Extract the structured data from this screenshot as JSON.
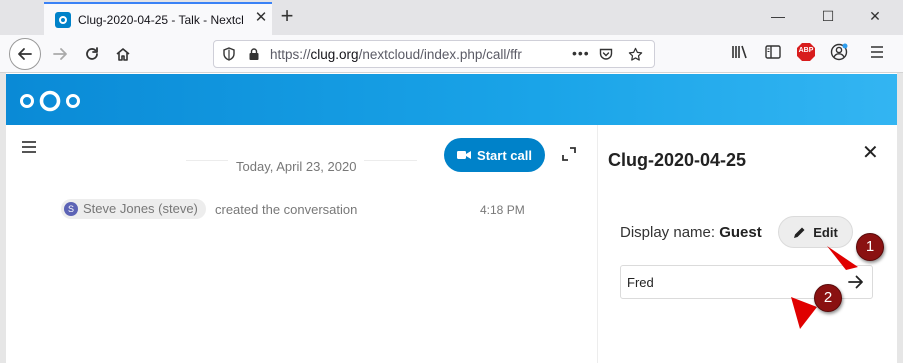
{
  "browser": {
    "tab_title": "Clug-2020-04-25 - Talk - Nextcl",
    "url_prefix": "https://",
    "url_host": "clug.org",
    "url_path": "/nextcloud/index.php/call/ffr",
    "abp_badge": "ABP"
  },
  "chat": {
    "date_separator": "Today, April 23, 2020",
    "start_call_label": "Start call",
    "message": {
      "avatar_initial": "S",
      "user": "Steve Jones (steve)",
      "text": "created the conversation",
      "time": "4:18 PM"
    }
  },
  "sidebar": {
    "title": "Clug-2020-04-25",
    "display_name_label": "Display name:",
    "display_name_value": "Guest",
    "edit_label": "Edit",
    "name_input_value": "Fred"
  },
  "annotations": {
    "marker_1": "1",
    "marker_2": "2",
    "marker_color": "#8a1111",
    "arrow_color": "#e00000"
  },
  "colors": {
    "brand": "#0082c9",
    "header_gradient_start": "#0a8ad6",
    "header_gradient_end": "#33b5f2"
  }
}
